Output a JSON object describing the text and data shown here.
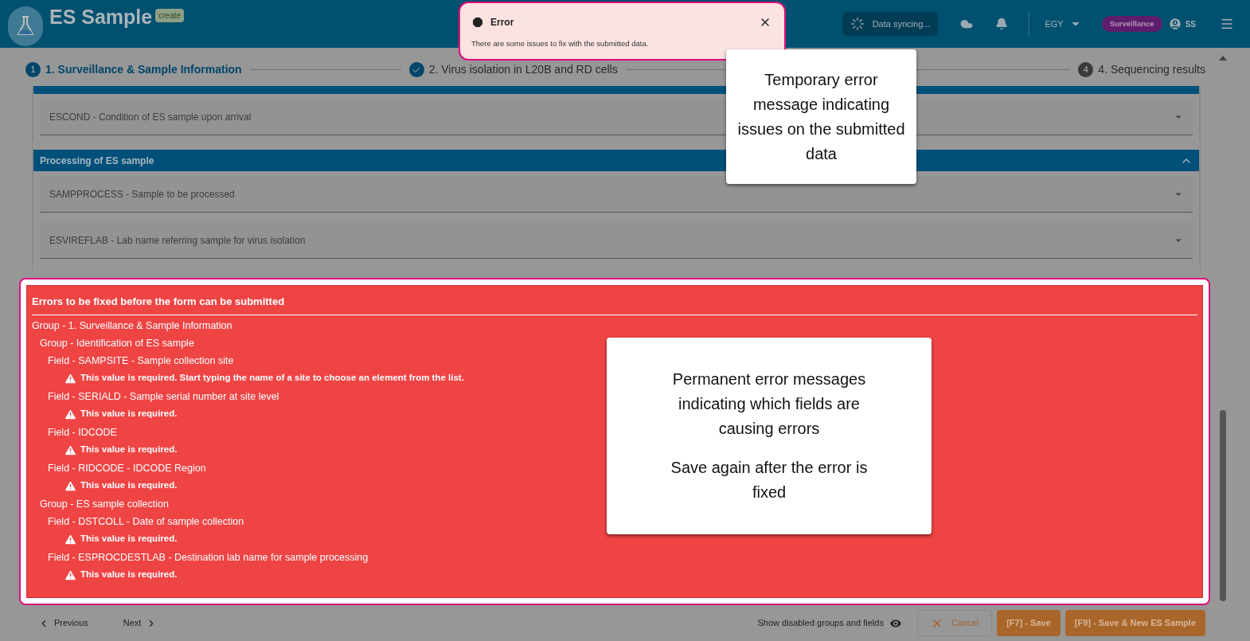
{
  "app": {
    "title": "ES Sample",
    "mode_badge": "create"
  },
  "header": {
    "sync_status": "Data syncing...",
    "country": "EGY",
    "role_badge": "Surveillance",
    "user": "SS"
  },
  "steps": [
    {
      "kind": "numbered",
      "number": "1",
      "label": "1. Surveillance & Sample Information",
      "selected": true
    },
    {
      "kind": "done",
      "label": "2. Virus isolation in L20B and RD cells",
      "selected": false
    },
    {
      "kind": "numbered",
      "number": "4",
      "label": "4. Sequencing results",
      "selected": false
    }
  ],
  "sections": [
    {
      "fields": [
        {
          "label": "ESCOND - Condition of ES sample upon arrival"
        }
      ]
    },
    {
      "title": "Processing of ES sample",
      "expanded": true,
      "fields": [
        {
          "label": "SAMPPROCESS - Sample to be processed"
        },
        {
          "label": "ESVIREFLAB - Lab name referring sample for virus isolation"
        }
      ]
    }
  ],
  "error_panel": {
    "title": "Errors to be fixed before the form can be submitted",
    "items": [
      {
        "kind": "group",
        "text": "Group - 1. Surveillance & Sample Information",
        "children": [
          {
            "kind": "group",
            "text": "Group - Identification of ES sample",
            "children": [
              {
                "kind": "field",
                "text": "Field - SAMPSITE - Sample collection site",
                "children": [
                  {
                    "kind": "message",
                    "text": "This value is required. Start typing the name of a site to choose an element from the list."
                  }
                ]
              },
              {
                "kind": "field",
                "text": "Field - SERIALD - Sample serial number at site level",
                "children": [
                  {
                    "kind": "message",
                    "text": "This value is required."
                  }
                ]
              },
              {
                "kind": "field",
                "text": "Field - IDCODE",
                "children": [
                  {
                    "kind": "message",
                    "text": "This value is required."
                  }
                ]
              },
              {
                "kind": "field",
                "text": "Field - RIDCODE - IDCODE Region",
                "children": [
                  {
                    "kind": "message",
                    "text": "This value is required."
                  }
                ]
              }
            ]
          },
          {
            "kind": "group",
            "text": "Group - ES sample collection",
            "children": [
              {
                "kind": "field",
                "text": "Field - DSTCOLL - Date of sample collection",
                "children": [
                  {
                    "kind": "message",
                    "text": "This value is required."
                  }
                ]
              },
              {
                "kind": "field",
                "text": "Field - ESPROCDESTLAB - Destination lab name for sample processing",
                "children": [
                  {
                    "kind": "message",
                    "text": "This value is required."
                  }
                ]
              }
            ]
          }
        ]
      }
    ]
  },
  "toast": {
    "title": "Error",
    "message": "There are some issues to fix with the submitted data."
  },
  "annotations": [
    {
      "paragraphs": [
        "Temporary error message indicating issues on the submitted data"
      ]
    },
    {
      "paragraphs": [
        "Permanent error messages indicating which fields are causing errors",
        "Save again after the error is fixed"
      ]
    }
  ],
  "footer": {
    "previous": "Previous",
    "next": "Next",
    "show_disabled": "Show disabled groups and fields",
    "buttons": [
      {
        "kind": "cancel",
        "label": "Cancel"
      },
      {
        "kind": "primary",
        "label": "[F7] - Save"
      },
      {
        "kind": "primary",
        "label": "[F9] - Save & New ES Sample"
      }
    ]
  }
}
